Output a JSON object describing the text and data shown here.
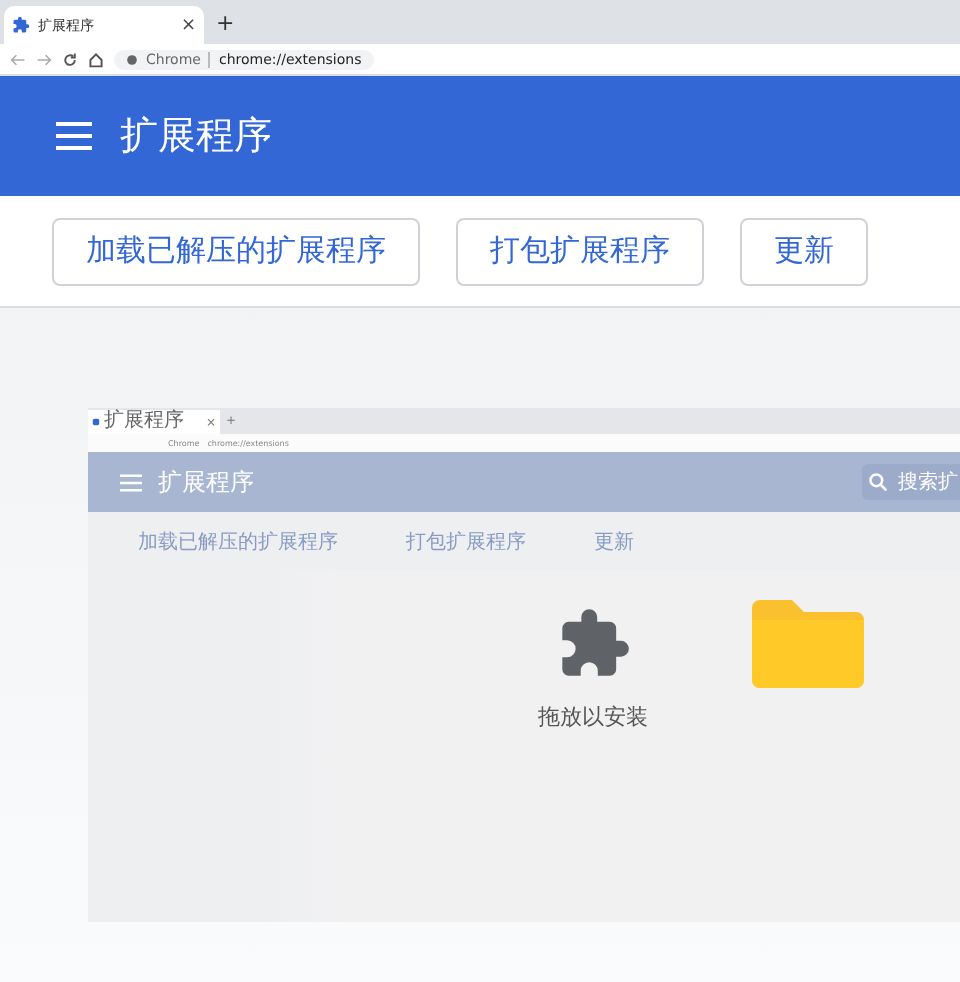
{
  "tab": {
    "title": "扩展程序",
    "close": "×",
    "new_tab": "+"
  },
  "address_bar": {
    "site": "Chrome",
    "url": "chrome://extensions"
  },
  "header": {
    "title": "扩展程序"
  },
  "buttons": [
    "加载已解压的扩展程序",
    "打包扩展程序",
    "更新"
  ],
  "inner_screenshot": {
    "tab": {
      "title": "扩展程序",
      "close": "×",
      "new_tab": "+"
    },
    "address_bar": {
      "site": "Chrome",
      "url": "chrome://extensions"
    },
    "header": {
      "title": "扩展程序",
      "search": "搜索扩"
    },
    "buttons": [
      "加载已解压的扩展程序",
      "打包扩展程序",
      "更新"
    ],
    "drop_label": "拖放以安装"
  }
}
